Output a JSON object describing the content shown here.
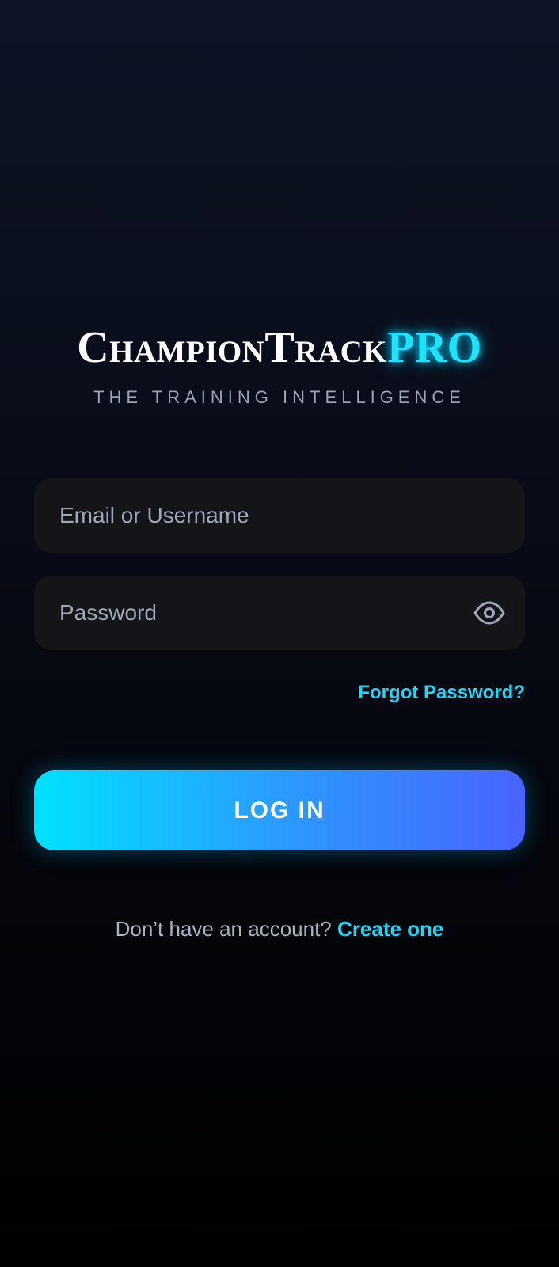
{
  "brand": {
    "name": "ChampionTrack",
    "suffix": "PRO",
    "tagline": "THE TRAINING INTELLIGENCE"
  },
  "form": {
    "email_placeholder": "Email or Username",
    "password_placeholder": "Password",
    "password_toggle_icon": "eye-icon",
    "forgot_label": "Forgot Password?",
    "login_label": "LOG IN"
  },
  "signup": {
    "prompt": "Don’t have an account?",
    "link": "Create one"
  },
  "colors": {
    "accent": "#1fd6f5",
    "button_gradient_start": "#00e1ff",
    "button_gradient_end": "#4a63ff",
    "field_background": "#141519",
    "background_top": "#0e1426",
    "background_bottom": "#000000"
  }
}
